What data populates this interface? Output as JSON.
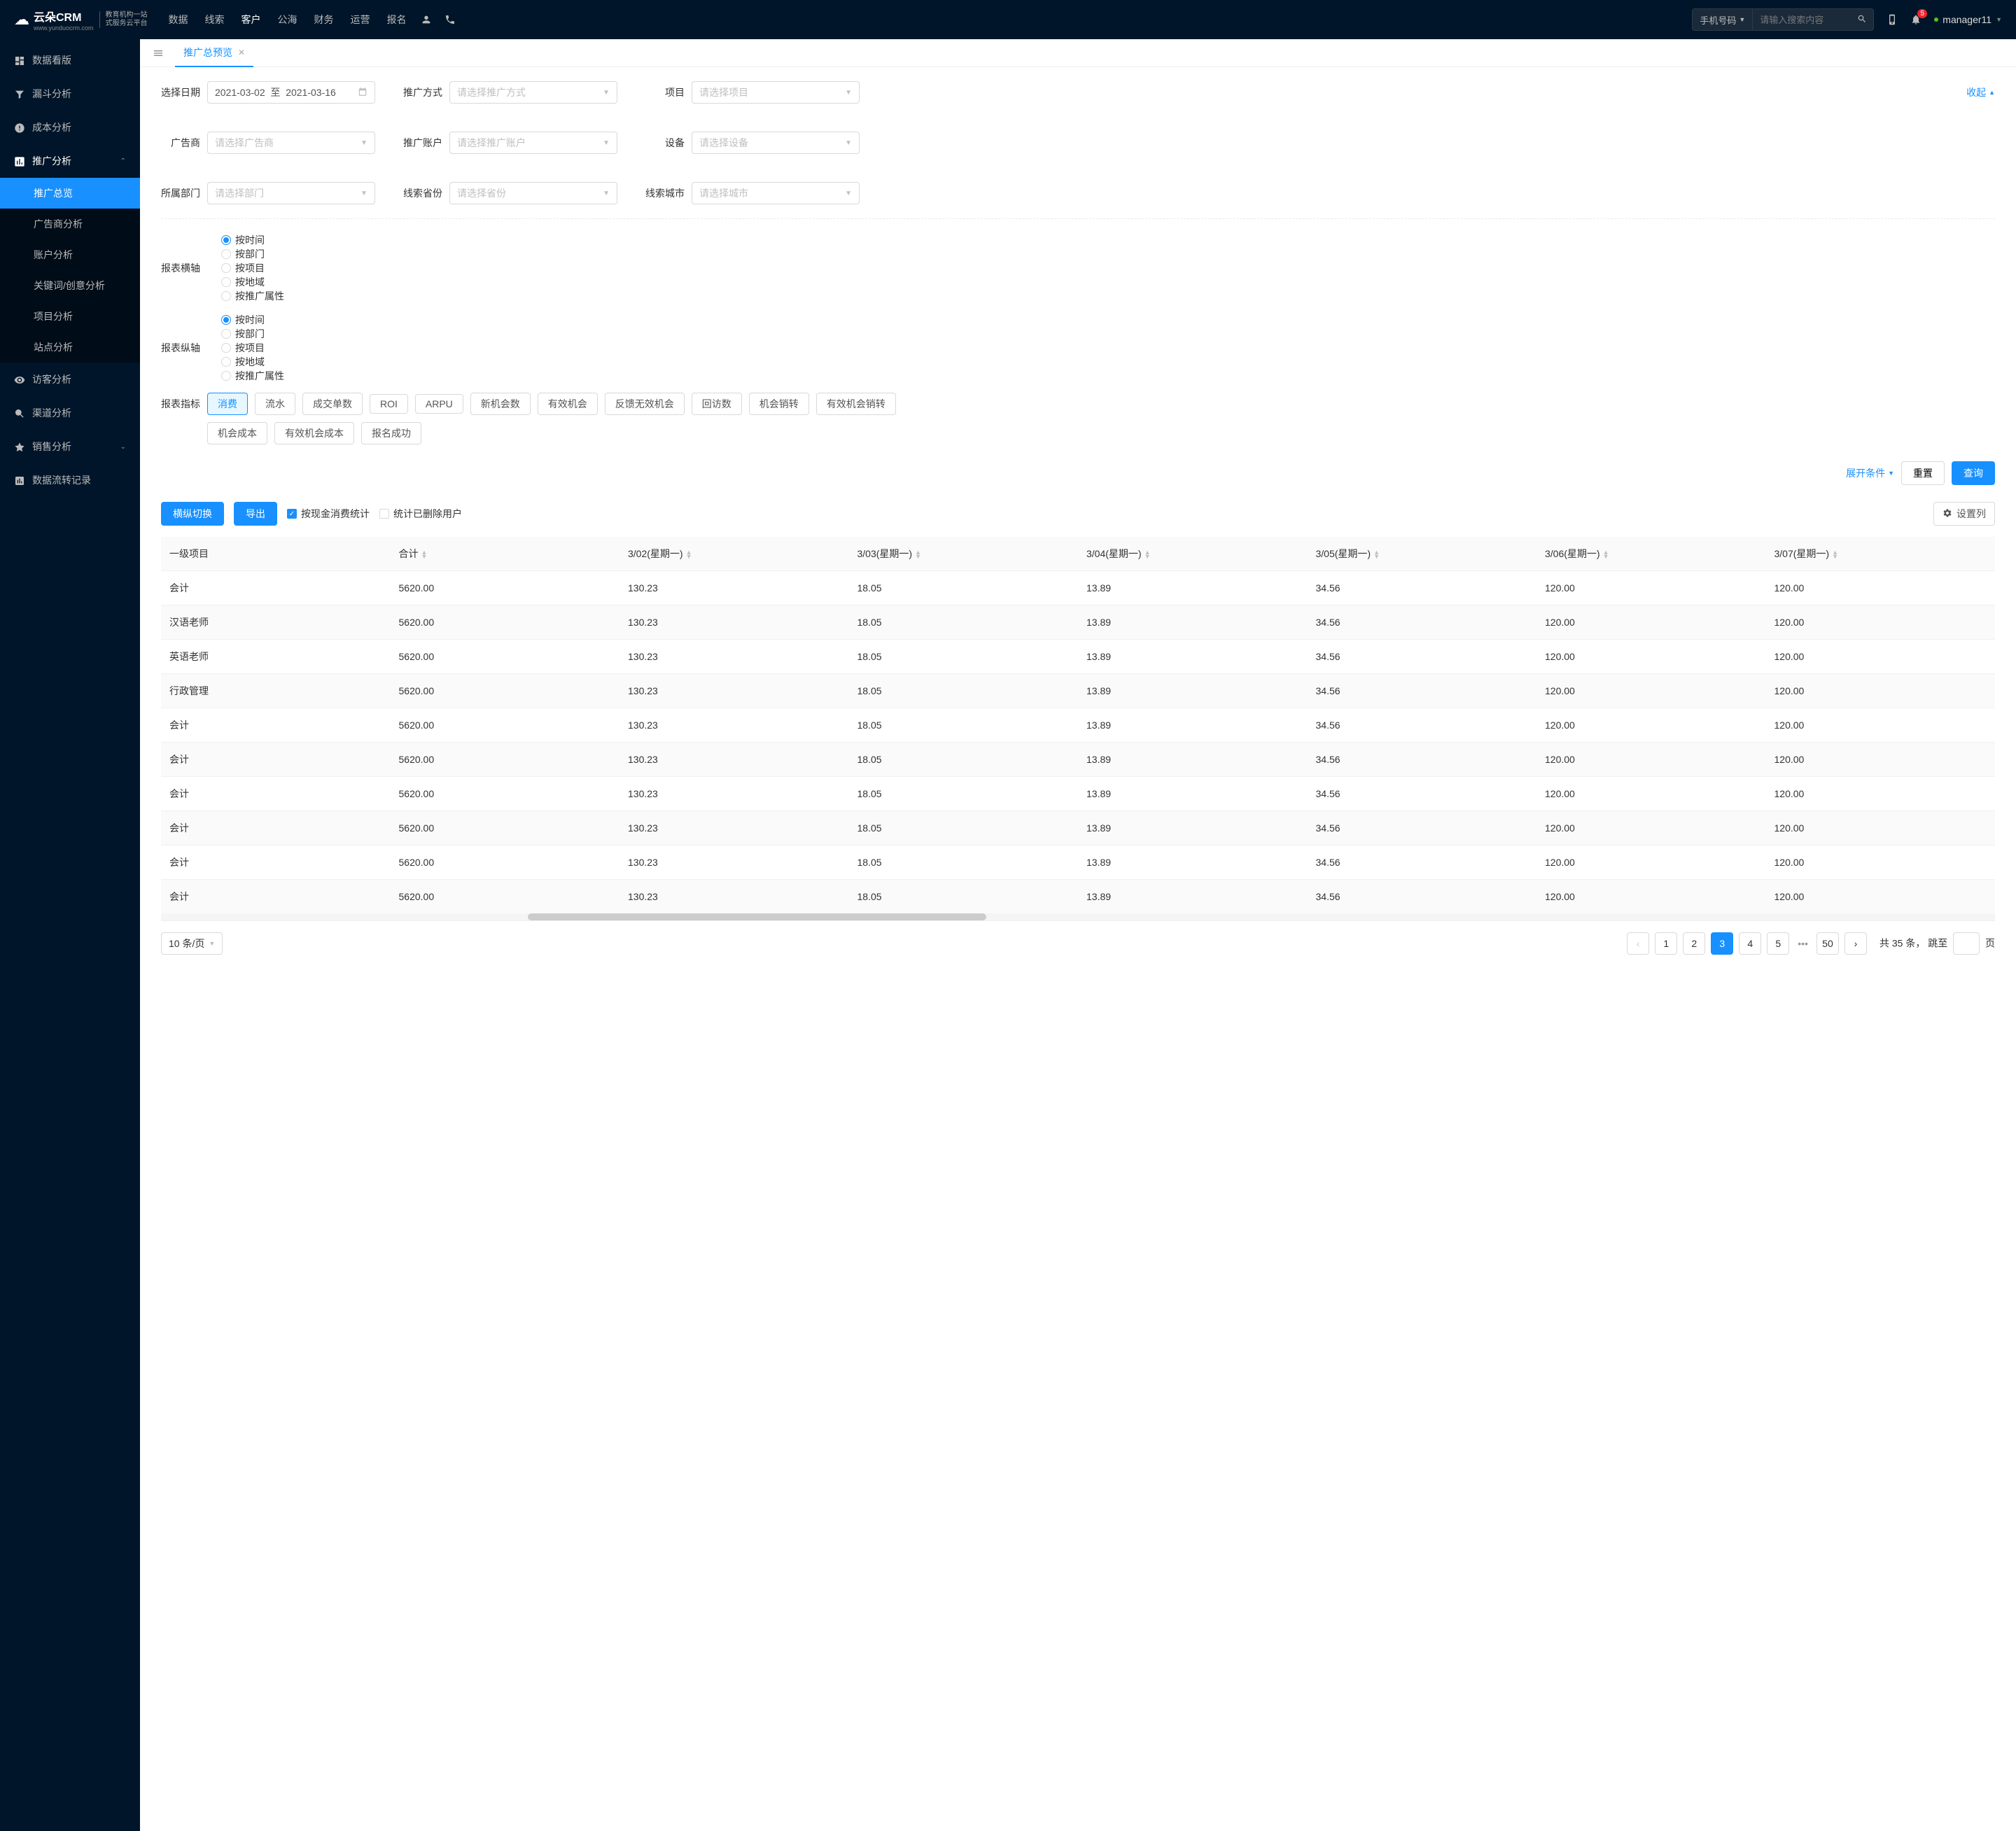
{
  "brand": {
    "name": "云朵CRM",
    "sub1": "教育机构一站",
    "sub2": "式服务云平台",
    "url": "www.yunduocrm.com"
  },
  "topnav": [
    "数据",
    "线索",
    "客户",
    "公海",
    "财务",
    "运营",
    "报名"
  ],
  "topnav_active": 2,
  "search": {
    "type": "手机号码",
    "placeholder": "请输入搜索内容"
  },
  "notif_count": "5",
  "user": "manager11",
  "sidebar": [
    {
      "icon": "dashboard",
      "label": "数据看版"
    },
    {
      "icon": "funnel",
      "label": "漏斗分析"
    },
    {
      "icon": "cost",
      "label": "成本分析"
    },
    {
      "icon": "promo",
      "label": "推广分析",
      "open": true,
      "children": [
        {
          "label": "推广总览",
          "active": true
        },
        {
          "label": "广告商分析"
        },
        {
          "label": "账户分析"
        },
        {
          "label": "关键词/创意分析"
        },
        {
          "label": "项目分析"
        },
        {
          "label": "站点分析"
        }
      ]
    },
    {
      "icon": "visitor",
      "label": "访客分析"
    },
    {
      "icon": "channel",
      "label": "渠道分析"
    },
    {
      "icon": "sales",
      "label": "销售分析",
      "arrow": true
    },
    {
      "icon": "flow",
      "label": "数据流转记录"
    }
  ],
  "tab": {
    "label": "推广总预览"
  },
  "filters": {
    "date_label": "选择日期",
    "date_from": "2021-03-02",
    "date_sep": "至",
    "date_to": "2021-03-16",
    "method_label": "推广方式",
    "method_ph": "请选择推广方式",
    "project_label": "项目",
    "project_ph": "请选择项目",
    "adv_label": "广告商",
    "adv_ph": "请选择广告商",
    "acct_label": "推广账户",
    "acct_ph": "请选择推广账户",
    "device_label": "设备",
    "device_ph": "请选择设备",
    "dept_label": "所属部门",
    "dept_ph": "请选择部门",
    "prov_label": "线索省份",
    "prov_ph": "请选择省份",
    "city_label": "线索城市",
    "city_ph": "请选择城市",
    "collapse": "收起"
  },
  "axis": {
    "h_label": "报表横轴",
    "v_label": "报表纵轴",
    "opts": [
      "按时间",
      "按部门",
      "按项目",
      "按地域",
      "按推广属性"
    ],
    "h_sel": 0,
    "v_sel": 0
  },
  "metrics": {
    "label": "报表指标",
    "row1": [
      "消费",
      "流水",
      "成交单数",
      "ROI",
      "ARPU",
      "新机会数",
      "有效机会",
      "反馈无效机会",
      "回访数",
      "机会销转",
      "有效机会销转"
    ],
    "row2": [
      "机会成本",
      "有效机会成本",
      "报名成功"
    ],
    "active": 0
  },
  "actions": {
    "expand": "展开条件",
    "reset": "重置",
    "query": "查询"
  },
  "toolbar": {
    "switch": "横纵切换",
    "export": "导出",
    "cb1": "按现金消费统计",
    "cb2": "统计已删除用户",
    "setcols": "设置列"
  },
  "table": {
    "cols": [
      "一级项目",
      "合计",
      "3/02(星期一)",
      "3/03(星期一)",
      "3/04(星期一)",
      "3/05(星期一)",
      "3/06(星期一)",
      "3/07(星期一)"
    ],
    "rows": [
      [
        "会计",
        "5620.00",
        "130.23",
        "18.05",
        "13.89",
        "34.56",
        "120.00",
        "120.00"
      ],
      [
        "汉语老师",
        "5620.00",
        "130.23",
        "18.05",
        "13.89",
        "34.56",
        "120.00",
        "120.00"
      ],
      [
        "英语老师",
        "5620.00",
        "130.23",
        "18.05",
        "13.89",
        "34.56",
        "120.00",
        "120.00"
      ],
      [
        "行政管理",
        "5620.00",
        "130.23",
        "18.05",
        "13.89",
        "34.56",
        "120.00",
        "120.00"
      ],
      [
        "会计",
        "5620.00",
        "130.23",
        "18.05",
        "13.89",
        "34.56",
        "120.00",
        "120.00"
      ],
      [
        "会计",
        "5620.00",
        "130.23",
        "18.05",
        "13.89",
        "34.56",
        "120.00",
        "120.00"
      ],
      [
        "会计",
        "5620.00",
        "130.23",
        "18.05",
        "13.89",
        "34.56",
        "120.00",
        "120.00"
      ],
      [
        "会计",
        "5620.00",
        "130.23",
        "18.05",
        "13.89",
        "34.56",
        "120.00",
        "120.00"
      ],
      [
        "会计",
        "5620.00",
        "130.23",
        "18.05",
        "13.89",
        "34.56",
        "120.00",
        "120.00"
      ],
      [
        "会计",
        "5620.00",
        "130.23",
        "18.05",
        "13.89",
        "34.56",
        "120.00",
        "120.00"
      ]
    ]
  },
  "pager": {
    "size": "10 条/页",
    "pages": [
      "1",
      "2",
      "3",
      "4",
      "5"
    ],
    "last": "50",
    "current": 2,
    "total_prefix": "共",
    "total_n": "35",
    "total_suffix": "条，",
    "jump": "跳至",
    "page_suffix": "页"
  }
}
